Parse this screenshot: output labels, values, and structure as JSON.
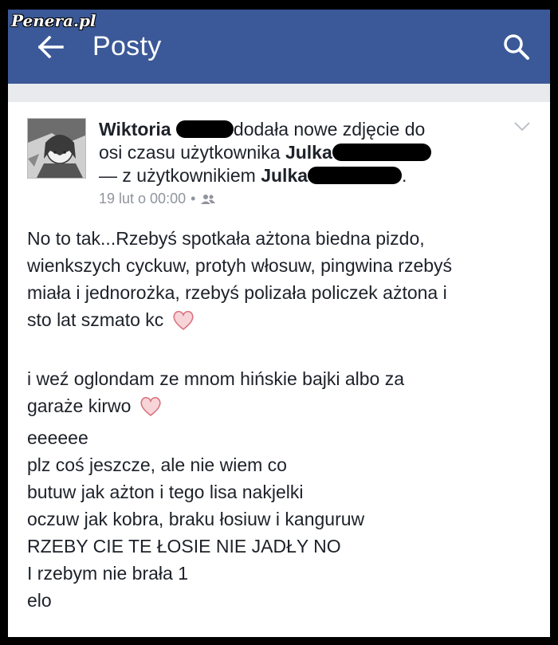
{
  "watermark": "Penera.pl",
  "appbar": {
    "title": "Posty",
    "back_icon": "arrow-left-icon",
    "search_icon": "search-icon",
    "color": "#3b5998"
  },
  "post": {
    "author": "Wiktoria",
    "action_1": "dodała nowe zdjęcie do",
    "action_2": "osi czasu użytkownika",
    "target_user": "Julka",
    "with_prefix": "— z użytkownikiem",
    "tagged_user": "Julka",
    "tail_period": ".",
    "timestamp": "19 lut o 00:00",
    "separator": "•",
    "audience_icon": "friends-icon",
    "menu_icon": "chevron-down-icon",
    "paragraph_1": [
      "No to tak...Rzebyś spotkała ażtona biedna pizdo,",
      "wienkszych cyckuw, protyh włosuw, pingwina rzebyś",
      "miała i jednorożka, rzebyś polizała policzek ażtona i",
      "sto lat szmato kc"
    ],
    "paragraph_2": [
      "i weź oglondam ze mnom hińskie bajki albo za",
      "garaże kirwo",
      "eeeeee",
      "plz coś jeszcze, ale nie wiem co",
      "butuw jak ażton i tego lisa nakjelki",
      "oczuw jak kobra, braku łosiuw i kanguruw",
      "RZEBY CIE TE ŁOSIE NIE JADŁY NO",
      "I rzebym nie brała 1",
      "elo"
    ],
    "emoji": "heart-icon"
  }
}
